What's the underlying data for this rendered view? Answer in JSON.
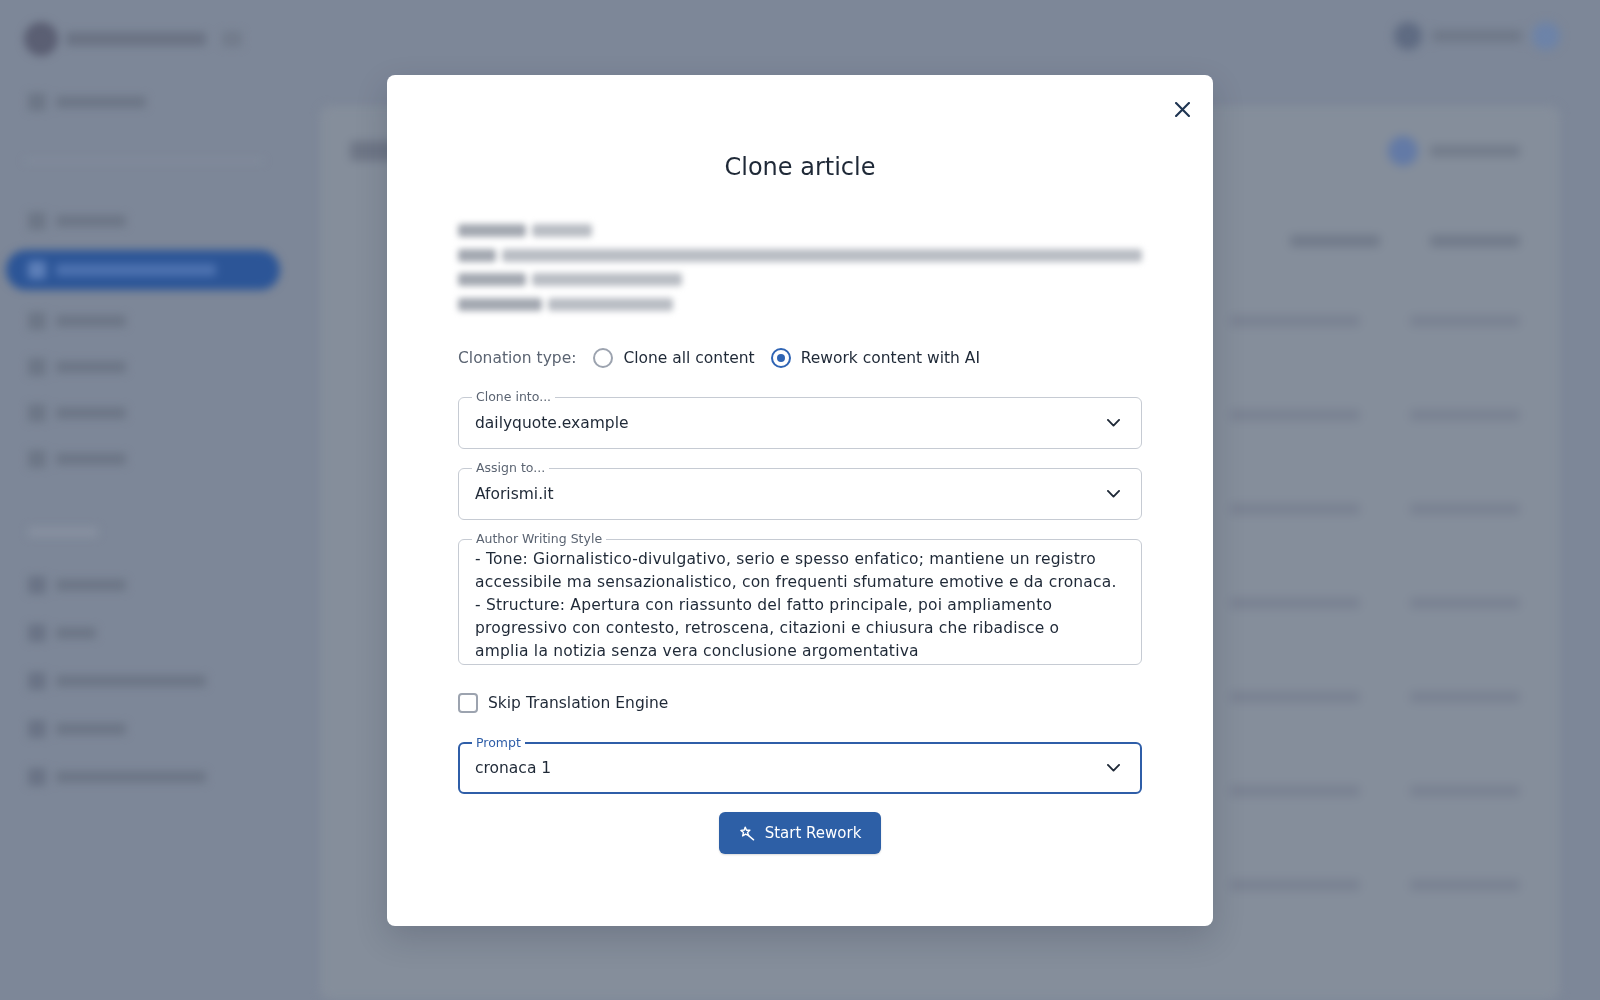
{
  "dialog": {
    "title": "Clone article",
    "clonation_type": {
      "label": "Clonation type:",
      "options": [
        {
          "label": "Clone all content",
          "selected": false
        },
        {
          "label": "Rework content with AI",
          "selected": true
        }
      ]
    },
    "form_items": [
      {
        "kind": "select",
        "label": "Clone into...",
        "value": "dailyquote.example",
        "focused": false
      },
      {
        "kind": "select",
        "label": "Assign to...",
        "value": "Aforismi.it",
        "focused": false
      },
      {
        "kind": "textarea",
        "label": "Author Writing Style",
        "value": "- Tone: Giornalistico-divulgativo, serio e spesso enfatico; mantiene un registro accessibile ma sensazionalistico, con frequenti sfumature emotive e da cronaca.\n- Structure: Apertura con riassunto del fatto principale, poi ampliamento progressivo con contesto, retroscena, citazioni e chiusura che ribadisce o amplia la notizia senza vera conclusione argomentativa",
        "focused": false
      },
      {
        "kind": "checkbox",
        "label": "Skip Translation Engine",
        "checked": false
      },
      {
        "kind": "select",
        "label": "Prompt",
        "value": "cronaca 1",
        "focused": true
      }
    ],
    "submit_button": {
      "label": "Start Rework"
    }
  }
}
